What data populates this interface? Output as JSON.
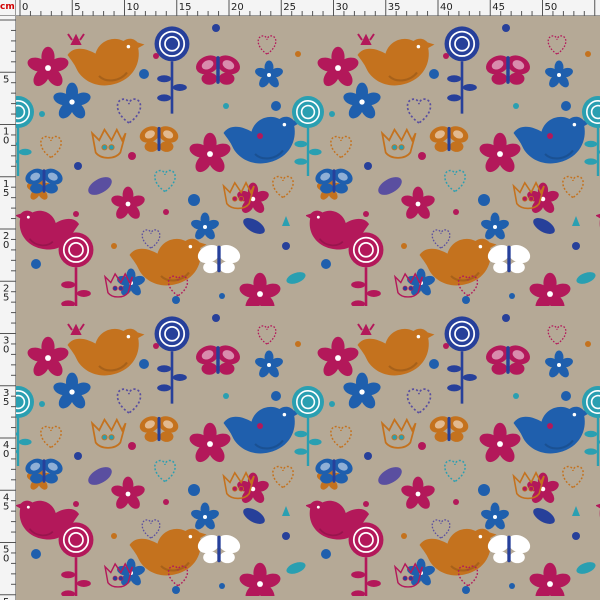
{
  "ruler": {
    "unit": "cm",
    "unit_color": "#d10000",
    "top_labels": [
      "0",
      "5",
      "10",
      "15",
      "20",
      "25",
      "30",
      "35",
      "40",
      "45",
      "50"
    ],
    "left_labels": [
      "5",
      "10",
      "15",
      "20",
      "25",
      "30",
      "35",
      "40",
      "45",
      "50",
      "55"
    ]
  },
  "pattern": {
    "background": "#b5a996",
    "colors": {
      "magenta": "#b3185a",
      "orange": "#c4721e",
      "blue": "#1f5fad",
      "navy": "#27409a",
      "teal": "#2a9fb1",
      "purple": "#5a4fa0",
      "white": "#ffffff"
    },
    "motifs": [
      "bird-icon",
      "flower-icon",
      "butterfly-icon",
      "heart-icon",
      "tulip-icon",
      "lollipop-flower-icon",
      "dot-icon"
    ]
  }
}
